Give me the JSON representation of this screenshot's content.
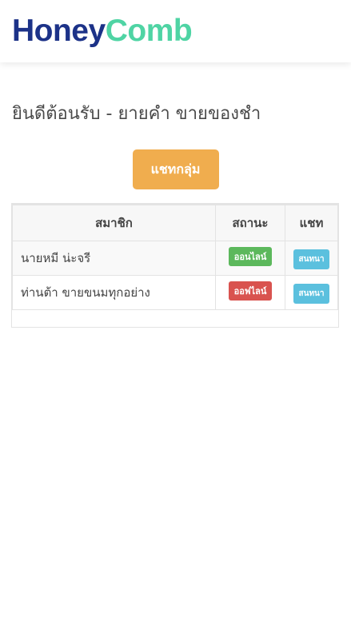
{
  "brand": {
    "part1": "Honey",
    "part2": "Comb"
  },
  "welcome_text": "ยินดีต้อนรับ - ยายคำ ขายของชำ",
  "group_chat_button": "แชทกลุ่ม",
  "table": {
    "headers": [
      "สมาชิก",
      "สถานะ",
      "แชท"
    ],
    "rows": [
      {
        "member": "นายหมี น่ะจรี",
        "status": "ออนไลน์",
        "chat": "สนทนา"
      },
      {
        "member": "ท่านต้า ขายขนมทุกอย่าง",
        "status": "ออฟไลน์",
        "chat": "สนทนา"
      }
    ]
  },
  "colors": {
    "brand_primary": "#1c3288",
    "brand_accent": "#4fd4a4",
    "group_button": "#f0ad4e",
    "online": "#5cb85c",
    "offline": "#d9534f",
    "chat_button": "#5bc0de"
  }
}
